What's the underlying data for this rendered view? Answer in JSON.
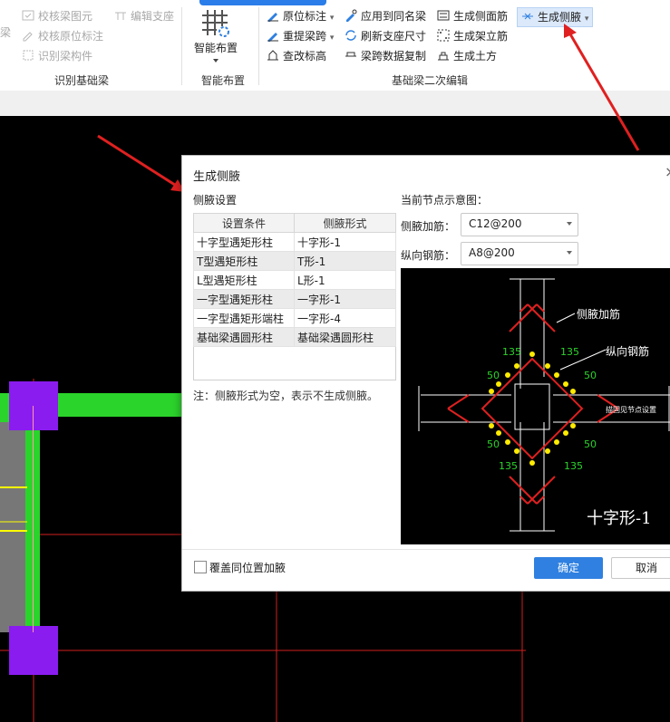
{
  "ribbon": {
    "identify_group": {
      "label": "识别基础梁",
      "partial_left": "梁",
      "items": [
        "校核梁图元",
        "校核原位标注",
        "识别梁构件"
      ],
      "edit_support": "编辑支座"
    },
    "smart_group": {
      "label": "智能布置",
      "button": "智能布置"
    },
    "secondary_group": {
      "label": "基础梁二次编辑",
      "col1": [
        "原位标注",
        "重提梁跨",
        "查改标高"
      ],
      "col2": [
        "应用到同名梁",
        "刷新支座尺寸",
        "梁跨数据复制"
      ],
      "col3": [
        "生成侧面筋",
        "生成架立筋",
        "生成土方"
      ],
      "active": "生成侧腋"
    }
  },
  "dialog": {
    "title": "生成侧腋",
    "close": "×",
    "settings_title": "侧腋设置",
    "table": {
      "headers": [
        "设置条件",
        "侧腋形式"
      ],
      "rows": [
        [
          "十字型遇矩形柱",
          "十字形-1"
        ],
        [
          "T型遇矩形柱",
          "T形-1"
        ],
        [
          "L型遇矩形柱",
          "L形-1"
        ],
        [
          "一字型遇矩形柱",
          "一字形-1"
        ],
        [
          "一字型遇矩形端柱",
          "一字形-4"
        ],
        [
          "基础梁遇圆形柱",
          "基础梁遇圆形柱"
        ]
      ]
    },
    "note": "注：侧腋形式为空，表示不生成侧腋。",
    "preview_title": "当前节点示意图：",
    "haunch_rebar_label": "侧腋加筋：",
    "haunch_rebar_value": "C12@200",
    "long_rebar_label": "纵向钢筋：",
    "long_rebar_value": "A8@200",
    "preview": {
      "callout_haunch": "侧腋加筋",
      "callout_long": "纵向钢筋",
      "angle": "135",
      "dim": "50",
      "side_note": "描固见节点设置",
      "shape_name": "十字形-1"
    },
    "overwrite_label": "覆盖同位置加腋",
    "ok": "确定",
    "cancel": "取消"
  },
  "colors": {
    "accent": "#2f80e0",
    "beam_green": "#2bd42b",
    "column_purple": "#8a1cf0",
    "arrow_red": "#e02020"
  }
}
